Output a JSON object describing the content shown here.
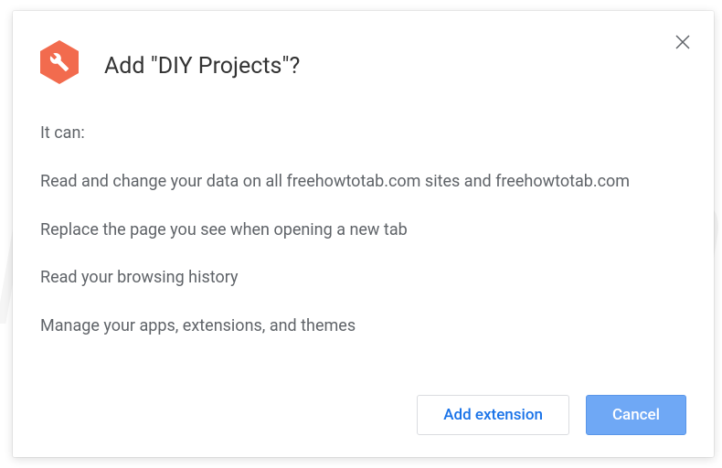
{
  "watermark": "pcrisk.com",
  "header": {
    "title": "Add \"DIY Projects\"?"
  },
  "content": {
    "intro": "It can:",
    "permissions": [
      "Read and change your data on all freehowtotab.com sites and freehowtotab.com",
      "Replace the page you see when opening a new tab",
      "Read your browsing history",
      "Manage your apps, extensions, and themes"
    ]
  },
  "footer": {
    "add_label": "Add extension",
    "cancel_label": "Cancel"
  }
}
